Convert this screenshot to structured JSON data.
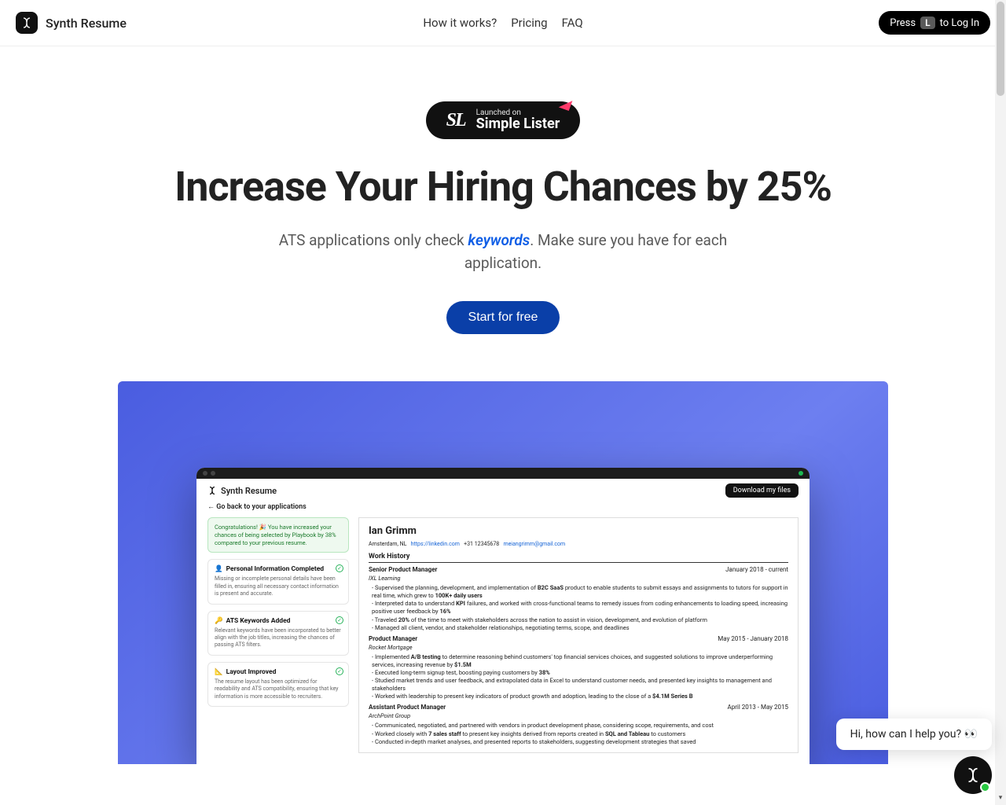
{
  "brand": {
    "name": "Synth Resume"
  },
  "nav": {
    "links": [
      "How it works?",
      "Pricing",
      "FAQ"
    ],
    "login_press": "Press",
    "login_key": "L",
    "login_rest": "to Log In"
  },
  "launch_badge": {
    "top": "Launched on",
    "bottom": "Simple Lister",
    "rocket": "🚀"
  },
  "headline": "Increase Your Hiring Chances by 25%",
  "subhead": {
    "before": "ATS applications only check ",
    "keyword": "keywords",
    "after": ". Make sure you have for each application."
  },
  "cta": "Start for free",
  "preview": {
    "brand": "Synth Resume",
    "download": "Download my files",
    "back": "Go back to your applications",
    "congrats": "Congratulations! 🎉 You have increased your chances of being selected by Playbook by 38% compared to your previous resume.",
    "cards": [
      {
        "icon": "👤",
        "title": "Personal Information Completed",
        "body": "Missing or incomplete personal details have been filled in, ensuring all necessary contact information is present and accurate."
      },
      {
        "icon": "🔑",
        "title": "ATS Keywords Added",
        "body": "Relevant keywords have been incorporated to better align with the job titles, increasing the chances of passing ATS filters."
      },
      {
        "icon": "📐",
        "title": "Layout Improved",
        "body": "The resume layout has been optimized for readability and ATS compatibility, ensuring that key information is more accessible to recruiters."
      }
    ],
    "resume": {
      "name": "Ian Grimm",
      "location": "Amsterdam, NL",
      "linkedin": "https://linkedin.com",
      "phone": "+31 12345678",
      "email": "meiangrimm@gmail.com",
      "section": "Work History",
      "jobs": [
        {
          "title": "Senior Product Manager",
          "dates": "January 2018 - current",
          "company": "IXL Learning",
          "bullets": [
            "Supervised the planning, development, and implementation of <b>B2C SaaS</b> product to enable students to submit essays and assignments to tutors for support in real time, which grew to <b>100K+ daily users</b>",
            "Interpreted data to understand <b>KPI</b> failures, and worked with cross-functional teams to remedy issues from coding enhancements to loading speed, increasing positive user feedback by <b>16%</b>",
            "Traveled <b>20%</b> of the time to meet with stakeholders across the nation to assist in vision, development, and evolution of platform",
            "Managed all client, vendor, and stakeholder relationships, negotiating terms, scope, and deadlines"
          ]
        },
        {
          "title": "Product Manager",
          "dates": "May 2015 - January 2018",
          "company": "Rocket Mortgage",
          "bullets": [
            "Implemented <b>A/B testing</b> to determine reasoning behind customers' top financial services choices, and suggested solutions to improve underperforming services, increasing revenue by <b>$1.5M</b>",
            "Executed long-term signup test, boosting paying customers by <b>38%</b>",
            "Studied market trends and user feedback, and extrapolated data in Excel to understand customer needs, and presented key insights to management and stakeholders",
            "Worked with leadership to present key indicators of product growth and adoption, leading to the close of a <b>$4.1M Series B</b>"
          ]
        },
        {
          "title": "Assistant Product Manager",
          "dates": "April 2013 - May 2015",
          "company": "ArchPoint Group",
          "bullets": [
            "Communicated, negotiated, and partnered with vendors in product development phase, considering scope, requirements, and cost",
            "Worked closely with <b>7 sales staff</b> to present key insights derived from reports created in <b>SQL and Tableau</b> to customers",
            "Conducted in-depth market analyses, and presented reports to stakeholders, suggesting development strategies that saved"
          ]
        }
      ]
    }
  },
  "chat": {
    "greeting": "Hi, how can I help you? 👀"
  }
}
